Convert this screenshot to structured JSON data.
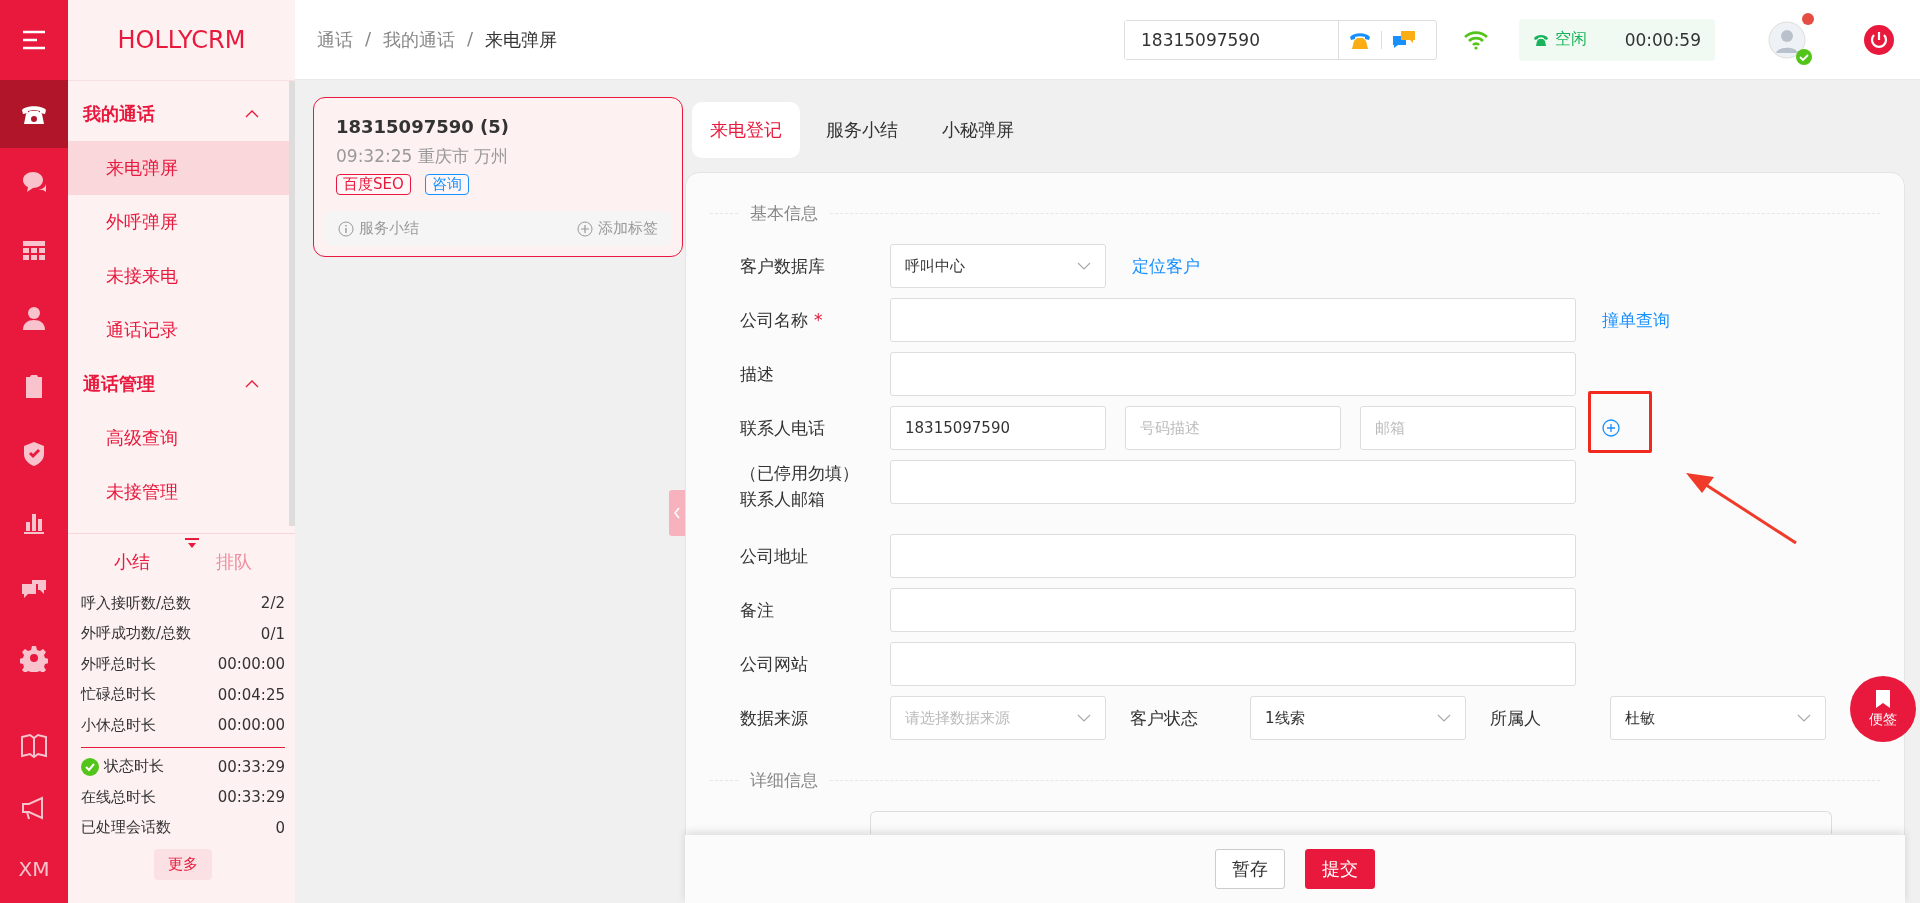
{
  "rail": {
    "items": [
      {
        "selected": true
      },
      {
        "selected": false
      },
      {
        "selected": false
      },
      {
        "selected": false
      },
      {
        "selected": false
      },
      {
        "selected": false
      },
      {
        "selected": false
      },
      {
        "selected": false
      },
      {
        "selected": false
      }
    ],
    "label": "XM"
  },
  "sidebar": {
    "brand": "HOLLYCRM",
    "groups": [
      {
        "title": "我的通话",
        "expanded": true,
        "items": [
          {
            "label": "来电弹屏",
            "selected": true
          },
          {
            "label": "外呼弹屏",
            "selected": false
          },
          {
            "label": "未接来电",
            "selected": false
          },
          {
            "label": "通话记录",
            "selected": false
          }
        ]
      },
      {
        "title": "通话管理",
        "expanded": true,
        "items": [
          {
            "label": "高级查询",
            "selected": false
          },
          {
            "label": "未接管理",
            "selected": false
          }
        ]
      }
    ],
    "stat_tabs": [
      {
        "label": "小结",
        "selected": true
      },
      {
        "label": "排队",
        "selected": false
      }
    ],
    "stats": [
      {
        "label": "呼入接听数/总数",
        "value": "2/2"
      },
      {
        "label": "外呼成功数/总数",
        "value": "0/1"
      },
      {
        "label": "外呼总时长",
        "value": "00:00:00"
      },
      {
        "label": "忙碌总时长",
        "value": "00:04:25"
      },
      {
        "label": "小休总时长",
        "value": "00:00:00"
      }
    ],
    "status_stats": [
      {
        "label": "状态时长",
        "value": "00:33:29",
        "kind": "status"
      },
      {
        "label": "在线总时长",
        "value": "00:33:29",
        "kind": "plain"
      },
      {
        "label": "已处理会话数",
        "value": "0",
        "kind": "plain"
      }
    ],
    "more_button": "更多"
  },
  "topbar": {
    "breadcrumb": [
      "通话",
      "我的通话",
      "来电弹屏"
    ],
    "breadcrumb_separator": "/",
    "phone": "18315097590",
    "status": {
      "label": "空闲",
      "timer": "00:00:59"
    }
  },
  "call_card": {
    "selected": true,
    "number": "18315097590 (5)",
    "meta": "09:32:25 重庆市 万州",
    "tags": [
      {
        "label": "百度SEO",
        "color": "#e8193c"
      },
      {
        "label": "咨询",
        "color": "#1890ff"
      }
    ],
    "actions": [
      "服务小结",
      "添加标签"
    ]
  },
  "tabs": [
    {
      "label": "来电登记",
      "selected": true
    },
    {
      "label": "服务小结",
      "selected": false
    },
    {
      "label": "小秘弹屏",
      "selected": false
    }
  ],
  "form": {
    "section": "基本信息",
    "rows": [
      {
        "kind": "select_link",
        "label": "客户数据库",
        "value": "呼叫中心",
        "link": "定位客户"
      },
      {
        "kind": "text_link",
        "label": "公司名称",
        "required_mark": "*",
        "link": "撞单查询"
      },
      {
        "kind": "text",
        "label": "描述"
      },
      {
        "kind": "contact",
        "label": "联系人电话",
        "fields": [
          {
            "value": "18315097590"
          },
          {
            "placeholder": "号码描述"
          },
          {
            "placeholder": "邮箱"
          }
        ]
      },
      {
        "kind": "text",
        "label_note": "（已停用勿填）",
        "label": "联系人邮箱"
      },
      {
        "kind": "text",
        "label": "公司地址"
      },
      {
        "kind": "text",
        "label": "备注"
      },
      {
        "kind": "text",
        "label": "公司网站"
      },
      {
        "kind": "selects",
        "items": [
          {
            "label": "数据来源",
            "placeholder": "请选择数据来源"
          },
          {
            "label": "客户状态",
            "value": "1线索"
          },
          {
            "label": "所属人",
            "value": "杜敏"
          }
        ]
      }
    ],
    "section2": "详细信息"
  },
  "footer_buttons": [
    {
      "label": "暂存",
      "kind": "default"
    },
    {
      "label": "提交",
      "kind": "primary"
    }
  ],
  "note_button": "便签"
}
